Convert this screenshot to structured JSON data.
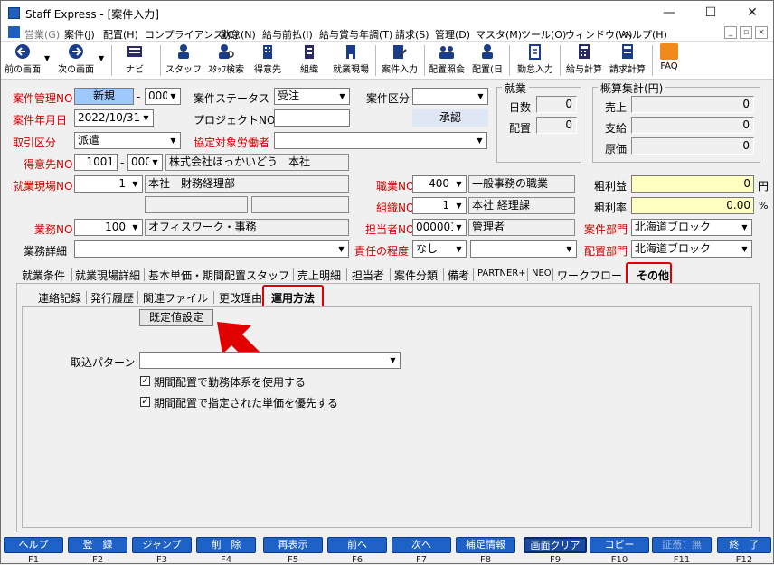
{
  "window": {
    "title": "Staff Express - [案件入力]"
  },
  "menu": [
    "営業(G)",
    "案件(J)",
    "配置(H)",
    "コンプライアンス(C)",
    "勤怠(N)",
    "給与前払(I)",
    "給与賞与年調(T)",
    "請求(S)",
    "管理(D)",
    "マスタ(M)",
    "ツール(O)",
    "ウィンドウ(W)",
    "ヘルプ(H)"
  ],
  "toolbar": [
    "前の画面",
    "次の画面",
    "ナビ",
    "スタッフ",
    "ｽﾀｯﾌ検索",
    "得意先",
    "組織",
    "就業現場",
    "案件入力",
    "配置照会",
    "配置(日",
    "勤怠入力",
    "給与計算",
    "請求計算",
    "FAQ"
  ],
  "form": {
    "case_mgmt_label": "案件管理NO",
    "case_mgmt_value": "新規",
    "case_mgmt_sub": "000",
    "case_status_label": "案件ステータス",
    "case_status_value": "受注",
    "case_category_label": "案件区分",
    "case_category_value": "",
    "case_date_label": "案件年月日",
    "case_date_value": "2022/10/31",
    "project_label": "プロジェクトNO",
    "project_value": "",
    "approve_label": "承認",
    "trade_label": "取引区分",
    "trade_value": "派遣",
    "agreement_label": "協定対象労働者",
    "agreement_value": "",
    "customer_label": "得意先NO",
    "customer_no": "1001",
    "customer_sub": "000",
    "customer_name": "株式会社ほっかいどう　本社",
    "site_label": "就業現場NO",
    "site_no": "1",
    "site_name": "本社　財務経理部",
    "job_label": "職業NO",
    "job_no": "400",
    "job_name": "一般事務の職業",
    "org_label": "組織NO",
    "org_no": "1",
    "org_name": "本社 経理課",
    "work_label": "業務NO",
    "work_no": "100",
    "work_name": "オフィスワーク・事務",
    "person_label": "担当者NO",
    "person_no": "000001",
    "person_name": "管理者",
    "case_dept_label": "案件部門",
    "case_dept_value": "北海道ブロック",
    "work_detail_label": "業務詳細",
    "work_detail_value": "",
    "responsibility_label": "責任の程度",
    "responsibility_value": "なし",
    "responsibility_sub": "",
    "assign_dept_label": "配置部門",
    "assign_dept_value": "北海道ブロック",
    "profit_label": "粗利益",
    "profit_value": "0",
    "profit_unit": "円",
    "profit_rate_label": "粗利率",
    "profit_rate_value": "0.00",
    "profit_rate_unit": "%"
  },
  "employment": {
    "title": "就業",
    "days_label": "日数",
    "days_value": "0",
    "assign_label": "配置",
    "assign_value": "0"
  },
  "summary": {
    "title": "概算集計(円)",
    "sales_label": "売上",
    "sales_value": "0",
    "pay_label": "支給",
    "pay_value": "0",
    "cost_label": "原価",
    "cost_value": "0"
  },
  "tabs": [
    "就業条件",
    "就業現場詳細",
    "基本単価・期間配置スタッフ",
    "売上明細",
    "担当者",
    "案件分類",
    "備考",
    "PARTNER+",
    "NEO",
    "ワークフロー",
    "その他"
  ],
  "subtabs": [
    "連絡記録",
    "発行履歴",
    "関連ファイル",
    "更改理由",
    "運用方法"
  ],
  "panel": {
    "default_button": "既定値設定",
    "import_label": "取込パターン",
    "import_value": "",
    "check1": "期間配置で勤務体系を使用する",
    "check2": "期間配置で指定された単価を優先する"
  },
  "fkeys": [
    {
      "label": "ヘルプ",
      "key": "F1"
    },
    {
      "label": "登　録",
      "key": "F2"
    },
    {
      "label": "ジャンプ",
      "key": "F3"
    },
    {
      "label": "削　除",
      "key": "F4"
    },
    {
      "label": "再表示",
      "key": "F5"
    },
    {
      "label": "前へ",
      "key": "F6"
    },
    {
      "label": "次へ",
      "key": "F7"
    },
    {
      "label": "補足情報",
      "key": "F8"
    },
    {
      "label": "画面クリア",
      "key": "F9"
    },
    {
      "label": "コピー",
      "key": "F10"
    },
    {
      "label": "証憑：無",
      "key": "F11"
    },
    {
      "label": "終　了",
      "key": "F12"
    }
  ],
  "colors": {
    "required_label": "#d00000",
    "highlight_field": "#9ec9ff",
    "yellow_field": "#ffffc0",
    "fkey_blue": "#1e62c8",
    "annotation_red": "#e00000"
  }
}
